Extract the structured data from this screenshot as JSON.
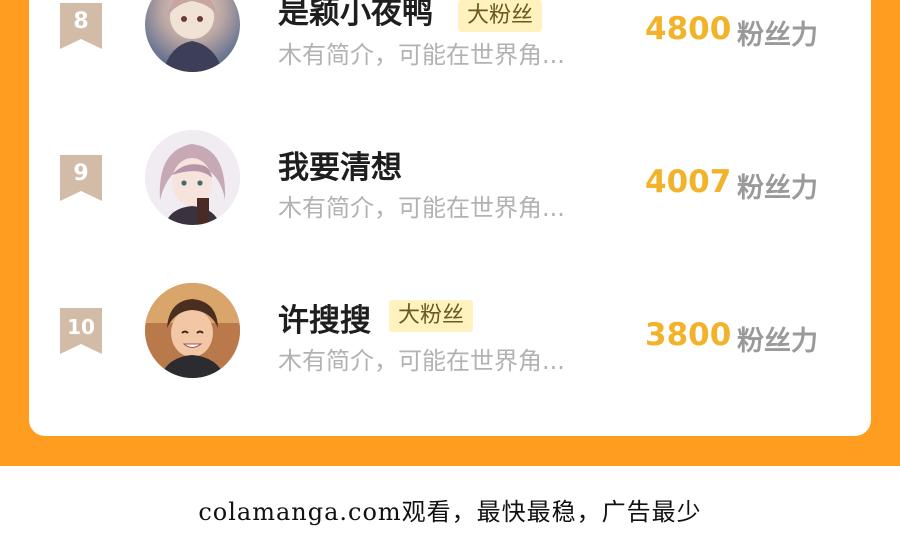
{
  "colors": {
    "frame_orange": "#ff9d21",
    "score_gold": "#f2b32a",
    "badge_bg": "#fff2bf",
    "rank_badge": "#d2bba7"
  },
  "ranking": [
    {
      "rank": "8",
      "name": "是颖小夜鸭",
      "badge": "大粉丝",
      "intro": "木有简介，可能在世界角...",
      "score": "4800",
      "score_unit": "粉丝力"
    },
    {
      "rank": "9",
      "name": "我要清想",
      "badge": "",
      "intro": "木有简介，可能在世界角...",
      "score": "4007",
      "score_unit": "粉丝力"
    },
    {
      "rank": "10",
      "name": "许搜搜",
      "badge": "大粉丝",
      "intro": "木有简介，可能在世界角...",
      "score": "3800",
      "score_unit": "粉丝力"
    }
  ],
  "footer": {
    "text": "colamanga.com观看，最快最稳，广告最少"
  }
}
